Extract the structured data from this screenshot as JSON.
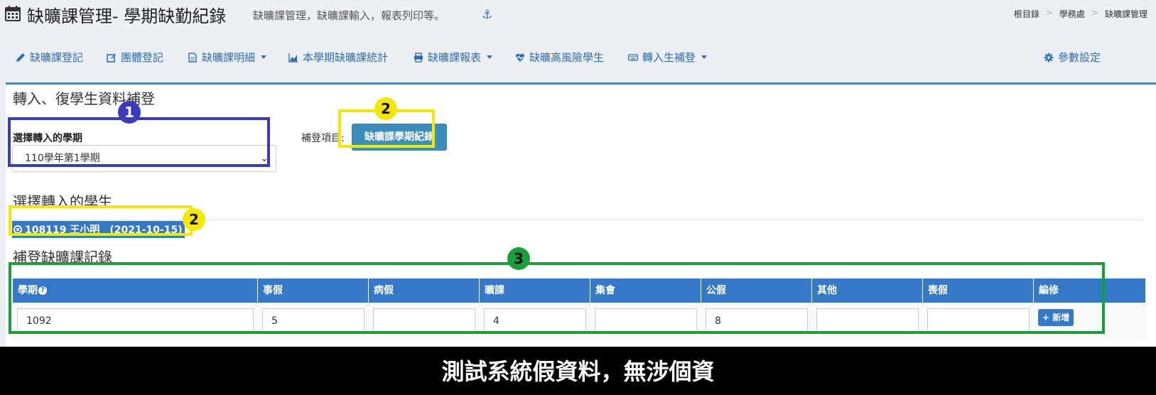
{
  "header": {
    "title": "缺曠課管理- 學期缺勤紀錄",
    "subtitle": "缺曠課管理，缺曠課輸入，報表列印等。",
    "breadcrumb": [
      "根目錄",
      "學務處",
      "缺曠課管理"
    ]
  },
  "nav": {
    "items": [
      {
        "label": "缺曠課登記",
        "icon": "pencil-icon",
        "dropdown": false
      },
      {
        "label": "團體登記",
        "icon": "edit-icon",
        "dropdown": false
      },
      {
        "label": "缺曠課明細",
        "icon": "file-icon",
        "dropdown": true
      },
      {
        "label": "本學期缺曠課統計",
        "icon": "area-chart-icon",
        "dropdown": false
      },
      {
        "label": "缺曠課報表",
        "icon": "print-icon",
        "dropdown": true
      },
      {
        "label": "缺曠高風險學生",
        "icon": "heartbeat-icon",
        "dropdown": false
      },
      {
        "label": "轉入生補登",
        "icon": "keyboard-icon",
        "dropdown": true
      }
    ],
    "settings_label": "參數設定"
  },
  "panel": {
    "title": "轉入、復學生資料補登",
    "semester_label": "選擇轉入的學期",
    "semester_value": "110學年第1學期",
    "make_up_label": "補登項目:",
    "record_button": "缺曠課學期紀錄",
    "student_section_title": "選擇轉入的學生",
    "student_entry": "108119 王小明　(2021-10-15)",
    "records_section_title": "補登缺曠課記錄"
  },
  "table": {
    "headers": [
      "學期",
      "事假",
      "病假",
      "曠課",
      "集會",
      "公假",
      "其他",
      "喪假",
      "編修"
    ],
    "row": [
      "1092",
      "5",
      "",
      "4",
      "",
      "8",
      "",
      ""
    ],
    "add_button": "+ 新增"
  },
  "annotations": {
    "markers": [
      "1",
      "2",
      "2",
      "3"
    ],
    "colors": {
      "blue": "#3b3bbf",
      "yellow": "#f5e800",
      "green": "#1a9e3a"
    }
  },
  "caption": "測試系統假資料，無涉個資",
  "colors": {
    "accent": "#3c8dbc",
    "header_blue": "#3478c8",
    "link": "#2c6fb3"
  }
}
